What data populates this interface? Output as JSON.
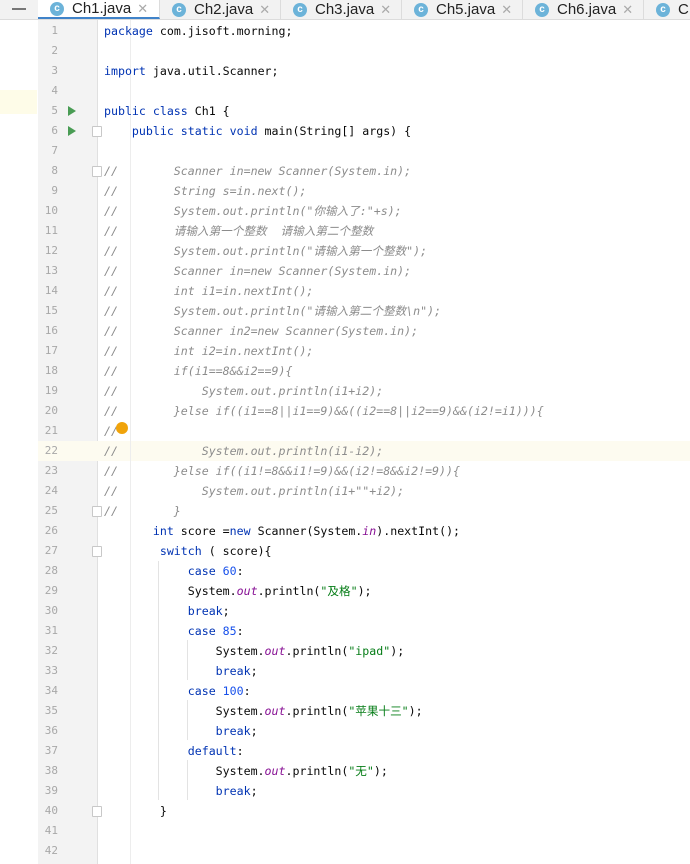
{
  "tabs": [
    {
      "label": "Ch1.java",
      "active": true
    },
    {
      "label": "Ch2.java"
    },
    {
      "label": "Ch3.java"
    },
    {
      "label": "Ch5.java"
    },
    {
      "label": "Ch6.java"
    },
    {
      "label": "C"
    }
  ],
  "editor": {
    "current_line": 22,
    "lines": [
      [
        [
          "package",
          "k"
        ],
        [
          " com.jisoft.morning;",
          ""
        ]
      ],
      [],
      [
        [
          "import",
          "k"
        ],
        [
          " java.util.Scanner;",
          ""
        ]
      ],
      [],
      [
        [
          "public class",
          "k"
        ],
        [
          " Ch1 {",
          ""
        ]
      ],
      [
        [
          "    public static void",
          "k"
        ],
        [
          " main(String[] args) {",
          ""
        ]
      ],
      [],
      [
        [
          "//        Scanner in=new Scanner(System.in);",
          "c"
        ]
      ],
      [
        [
          "//        String s=in.next();",
          "c"
        ]
      ],
      [
        [
          "//        System.out.println(\"你输入了:\"+s);",
          "c"
        ]
      ],
      [
        [
          "//        请输入第一个整数  请输入第二个整数",
          "c"
        ]
      ],
      [
        [
          "//        System.out.println(\"请输入第一个整数\");",
          "c"
        ]
      ],
      [
        [
          "//        Scanner in=new Scanner(System.in);",
          "c"
        ]
      ],
      [
        [
          "//        int i1=in.nextInt();",
          "c"
        ]
      ],
      [
        [
          "//        System.out.println(\"请输入第二个整数\\n\");",
          "c"
        ]
      ],
      [
        [
          "//        Scanner in2=new Scanner(System.in);",
          "c"
        ]
      ],
      [
        [
          "//        int i2=in.nextInt();",
          "c"
        ]
      ],
      [
        [
          "//        if(i1==8&&i2==9){",
          "c"
        ]
      ],
      [
        [
          "//            System.out.println(i1+i2);",
          "c"
        ]
      ],
      [
        [
          "//        }else if((i1==8||i1==9)&&((i2==8||i2==9)&&(i2!=i1))){",
          "c"
        ]
      ],
      [
        [
          "//",
          "c"
        ]
      ],
      [
        [
          "//            System.out.println(i1-i2);",
          "c"
        ]
      ],
      [
        [
          "//        }else if((i1!=8&&i1!=9)&&(i2!=8&&i2!=9)){",
          "c"
        ]
      ],
      [
        [
          "//            System.out.println(i1+\"\"+i2);",
          "c"
        ]
      ],
      [
        [
          "//        }",
          "c"
        ]
      ],
      [
        [
          "       int",
          "k"
        ],
        [
          " score =",
          ""
        ],
        [
          "new",
          "k"
        ],
        [
          " Scanner(System.",
          ""
        ],
        [
          "in",
          "f"
        ],
        [
          ").nextInt();",
          ""
        ]
      ],
      [
        [
          "        switch",
          "k"
        ],
        [
          " ( score){",
          ""
        ]
      ],
      [
        [
          "            case ",
          "k"
        ],
        [
          "60",
          "n"
        ],
        [
          ":",
          ""
        ]
      ],
      [
        [
          "            System.",
          ""
        ],
        [
          "out",
          "f"
        ],
        [
          ".println(",
          ""
        ],
        [
          "\"及格\"",
          "s"
        ],
        [
          ");",
          ""
        ]
      ],
      [
        [
          "            break",
          "k"
        ],
        [
          ";",
          ""
        ]
      ],
      [
        [
          "            case ",
          "k"
        ],
        [
          "85",
          "n"
        ],
        [
          ":",
          ""
        ]
      ],
      [
        [
          "                System.",
          ""
        ],
        [
          "out",
          "f"
        ],
        [
          ".println(",
          ""
        ],
        [
          "\"ipad\"",
          "s"
        ],
        [
          ");",
          ""
        ]
      ],
      [
        [
          "                break",
          "k"
        ],
        [
          ";",
          ""
        ]
      ],
      [
        [
          "            case ",
          "k"
        ],
        [
          "100",
          "n"
        ],
        [
          ":",
          ""
        ]
      ],
      [
        [
          "                System.",
          ""
        ],
        [
          "out",
          "f"
        ],
        [
          ".println(",
          ""
        ],
        [
          "\"苹果十三\"",
          "s"
        ],
        [
          ");",
          ""
        ]
      ],
      [
        [
          "                break",
          "k"
        ],
        [
          ";",
          ""
        ]
      ],
      [
        [
          "            default",
          "k"
        ],
        [
          ":",
          ""
        ]
      ],
      [
        [
          "                System.",
          ""
        ],
        [
          "out",
          "f"
        ],
        [
          ".println(",
          ""
        ],
        [
          "\"无\"",
          "s"
        ],
        [
          ");",
          ""
        ]
      ],
      [
        [
          "                break",
          "k"
        ],
        [
          ";",
          ""
        ]
      ],
      [
        [
          "        }",
          ""
        ]
      ],
      [],
      []
    ]
  },
  "colors": {
    "keyword": "#0033b3",
    "number": "#1750eb",
    "string": "#067d17",
    "field": "#871094",
    "comment": "#8c8c8c",
    "tab_underline": "#4083c9"
  }
}
